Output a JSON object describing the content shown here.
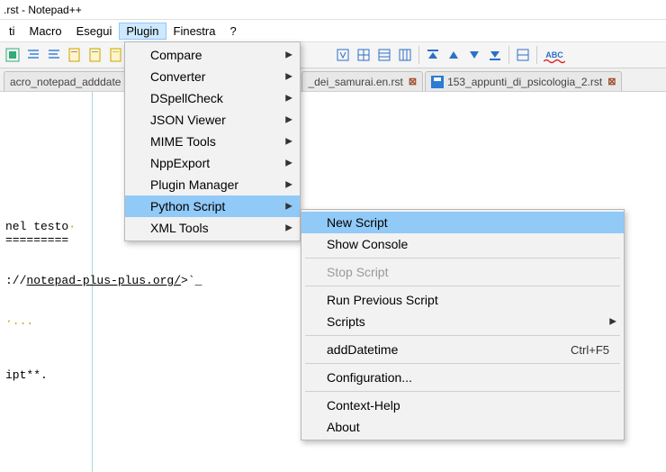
{
  "title": ".rst - Notepad++",
  "menubar": {
    "items": [
      "ti",
      "Macro",
      "Esegui",
      "Plugin",
      "Finestra",
      "?"
    ],
    "open_index": 3
  },
  "tabs": [
    {
      "label": "acro_notepad_adddate"
    },
    {
      "label": "_dei_samurai.en.rst"
    },
    {
      "label": "153_appunti_di_psicologia_2.rst"
    }
  ],
  "editor": {
    "line1": "nel testo",
    "line2": "=========",
    "link_prefix": "://",
    "link_text": "notepad-plus-plus.org/",
    "link_suffix": ">`_",
    "ellipsis": "·...",
    "lastline": "ipt**."
  },
  "plugin_menu": {
    "items": [
      {
        "label": "Compare",
        "arrow": true
      },
      {
        "label": "Converter",
        "arrow": true
      },
      {
        "label": "DSpellCheck",
        "arrow": true
      },
      {
        "label": "JSON Viewer",
        "arrow": true
      },
      {
        "label": "MIME Tools",
        "arrow": true
      },
      {
        "label": "NppExport",
        "arrow": true
      },
      {
        "label": "Plugin Manager",
        "arrow": true
      },
      {
        "label": "Python Script",
        "arrow": true,
        "hover": true
      },
      {
        "label": "XML Tools",
        "arrow": true
      }
    ]
  },
  "python_menu": {
    "groups": [
      [
        {
          "label": "New Script",
          "hover": true
        },
        {
          "label": "Show Console"
        }
      ],
      [
        {
          "label": "Stop Script",
          "disabled": true
        }
      ],
      [
        {
          "label": "Run Previous Script"
        },
        {
          "label": "Scripts",
          "arrow": true
        }
      ],
      [
        {
          "label": "addDatetime",
          "shortcut": "Ctrl+F5"
        }
      ],
      [
        {
          "label": "Configuration..."
        }
      ],
      [
        {
          "label": "Context-Help"
        },
        {
          "label": "About"
        }
      ]
    ]
  },
  "toolbar_right": {
    "abc": "ABC"
  }
}
